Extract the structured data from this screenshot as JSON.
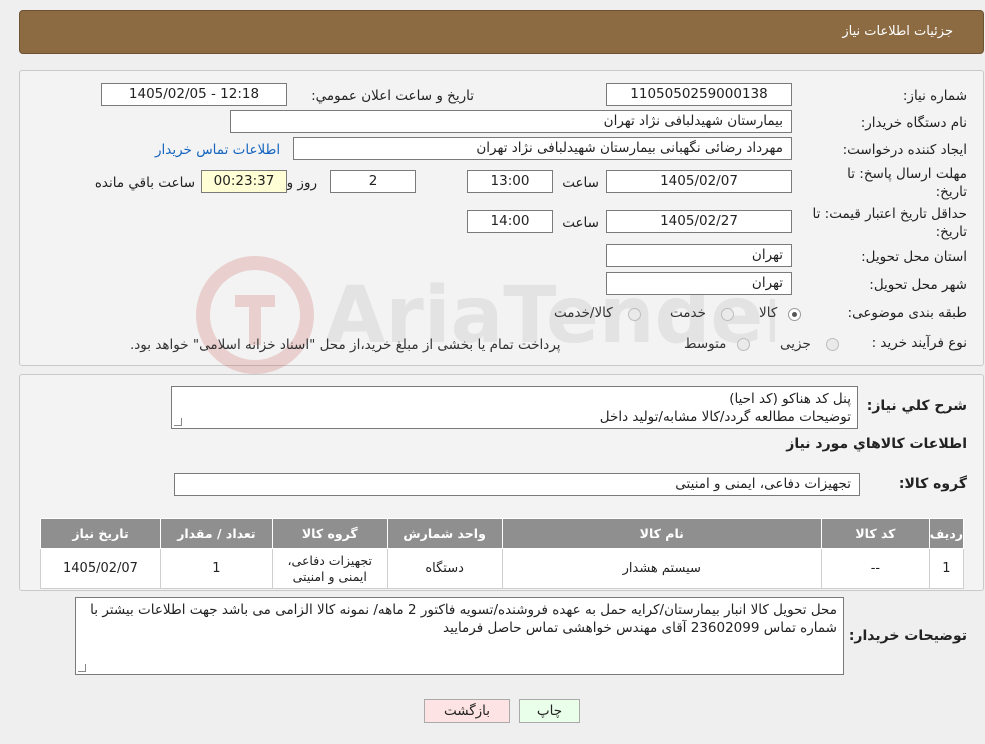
{
  "header": {
    "title": "جزئيات اطلاعات نياز"
  },
  "form": {
    "need_number_label": "شماره نیاز:",
    "need_number": "1105050259000138",
    "announce_label": "تاريخ و ساعت اعلان عمومي:",
    "announce_value": "1405/02/05 - 12:18",
    "buyer_org_label": "نام دستگاه خريدار:",
    "buyer_org": "بیمارستان شهیدلبافی نژاد تهران",
    "requester_label": "ايجاد کننده درخواست:",
    "requester": "مهرداد رضائی نگهبانی بیمارستان شهیدلبافی نژاد تهران",
    "contact_link": "اطلاعات تماس خريدار",
    "deadline_label_1": "مهلت ارسال پاسخ: تا",
    "deadline_label_2": "تاريخ:",
    "deadline_date": "1405/02/07",
    "time_label": "ساعت",
    "deadline_time": "13:00",
    "days_value": "2",
    "days_label": "روز و",
    "remaining_time": "00:23:37",
    "remaining_label": "ساعت باقي مانده",
    "validity_label_1": "حداقل تاريخ اعتبار قيمت: تا",
    "validity_label_2": "تاريخ:",
    "validity_date": "1405/02/27",
    "validity_time": "14:00",
    "province_label": "استان محل تحويل:",
    "province": "تهران",
    "city_label": "شهر محل تحويل:",
    "city": "تهران",
    "category_label": "طبقه بندی موضوعی:",
    "category_options": [
      "کالا",
      "خدمت",
      "کالا/خدمت"
    ],
    "category_selected": "کالا",
    "process_label": "نوع فرآیند خرید :",
    "process_options": [
      "جزیی",
      "متوسط"
    ],
    "process_note": "پرداخت تمام یا بخشی از مبلغ خرید،از محل \"اسناد خزانه اسلامی\" خواهد بود."
  },
  "summary": {
    "label": "شرح کلي نياز:",
    "line1": "پنل کد هناکو (کد احیا)",
    "line2": "توضیحات مطالعه گردد/کالا مشابه/تولید داخل"
  },
  "goods": {
    "section_title": "اطلاعات کالاهاي مورد نياز",
    "group_label": "گروه کالا:",
    "group_value": "تجهیزات دفاعی، ایمنی و امنیتی",
    "columns": [
      "رديف",
      "کد کالا",
      "نام کالا",
      "واحد شمارش",
      "گروه کالا",
      "تعداد / مقدار",
      "تاريخ نياز"
    ],
    "rows": [
      [
        "1",
        "--",
        "سیستم هشدار",
        "دستگاه",
        "تجهیزات دفاعی، ایمنی و امنیتی",
        "1",
        "1405/02/07"
      ]
    ]
  },
  "buyer_notes": {
    "label": "توضيحات خريدار:",
    "text": "محل تحویل کالا انبار بیمارستان/کرایه حمل به عهده  فروشنده/تسویه فاکتور 2 ماهه/ نمونه کالا الزامی می باشد جهت اطلاعات بیشتر با شماره تماس 23602099 آقای مهندس خواهشی تماس حاصل فرمایید"
  },
  "buttons": {
    "print": "چاپ",
    "back": "بازگشت"
  },
  "watermark_text": "AriaTender.neT",
  "colors": {
    "header_bg": "#8c6b43",
    "table_header_bg": "#8f8f8f",
    "link": "#1565c0",
    "back_button_bg": "#fde3e3",
    "print_button_bg": "#eaffea"
  }
}
